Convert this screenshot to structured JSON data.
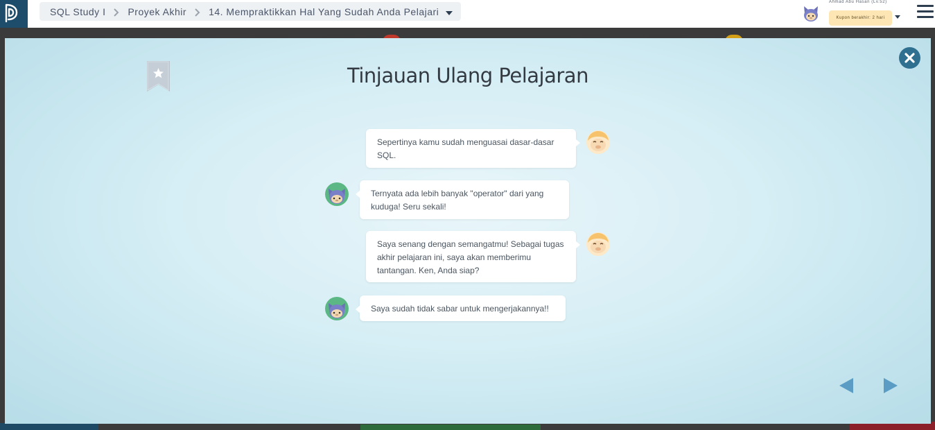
{
  "nav": {
    "breadcrumb": [
      "SQL Study I",
      "Proyek Akhir",
      "14. Mempraktikkan Hal Yang Sudah Anda Pelajari"
    ],
    "user_name": "Ahmad Abu Hasan (Lv.52)",
    "coupon_text": "Kupon berakhir: 2 hari"
  },
  "modal": {
    "title": "Tinjauan Ulang Pelajaran",
    "messages": [
      {
        "speaker": "mentor",
        "text": "Sepertinya kamu sudah menguasai dasar-dasar SQL."
      },
      {
        "speaker": "student",
        "text": "Ternyata ada lebih banyak \"operator\" dari yang kuduga! Seru sekali!"
      },
      {
        "speaker": "mentor",
        "text": "Saya senang dengan semangatmu! Sebagai tugas akhir pelajaran ini, saya akan memberimu tantangan. Ken, Anda siap?"
      },
      {
        "speaker": "student",
        "text": "Saya sudah tidak sabar untuk mengerjakannya!!"
      }
    ]
  },
  "icons": {
    "logo": "progate-logo-icon",
    "close": "close-icon",
    "bookmark": "bookmark-star-icon",
    "prev": "prev-arrow-icon",
    "next": "next-arrow-icon",
    "menu": "hamburger-menu-icon"
  },
  "colors": {
    "nav_dark": "#1e4d6b",
    "accent": "#2f6f8f",
    "arrow": "#5a9cc4",
    "coupon_bg": "#fde6b3"
  }
}
